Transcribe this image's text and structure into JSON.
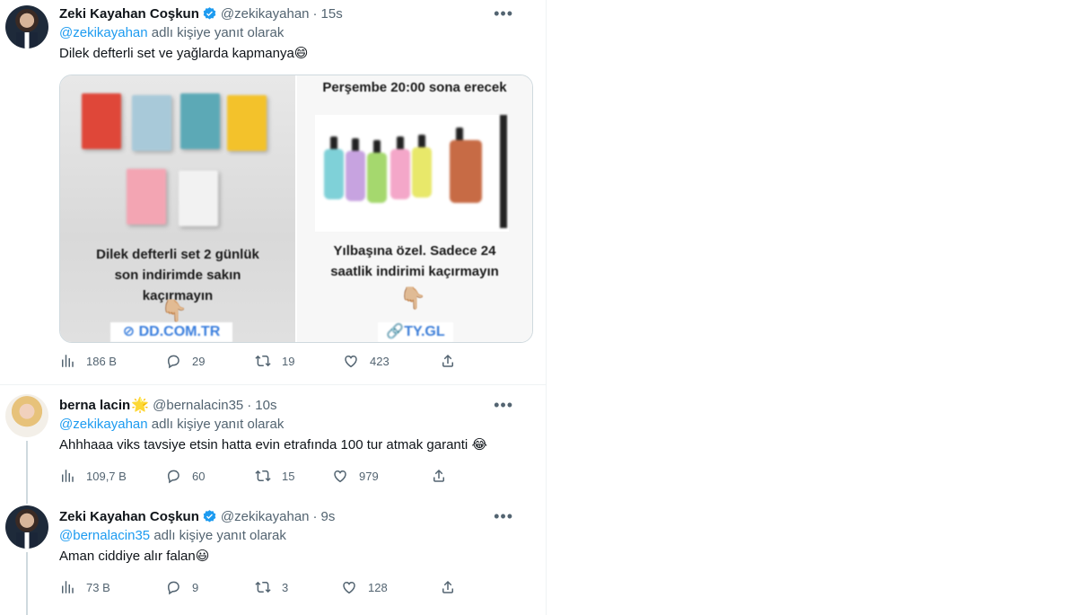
{
  "tweets": [
    {
      "name": "Zeki Kayahan Coşkun",
      "handle": "@zekikayahan",
      "time": "15s",
      "reply_mention": "@zekikayahan",
      "reply_suffix": "adlı kişiye yanıt olarak",
      "text": "Dilek defterli set ve yağlarda kapmanya",
      "emoji": "😄",
      "verified": true,
      "media": {
        "left_caption_1": "Dilek defterli set 2 günlük",
        "left_caption_2": "son indirimde sakın",
        "left_caption_3": "kaçırmayın",
        "left_link": "⊘ DD.COM.TR",
        "right_header": "Perşembe 20:00 sona erecek",
        "right_caption_1": "Yılbaşına özel. Sadece 24",
        "right_caption_2": "saatlik indirimi kaçırmayın",
        "right_link": "🔗TY.GL",
        "pointer": "👇🏼"
      },
      "views": "186 B",
      "replies": "29",
      "retweets": "19",
      "likes": "423"
    },
    {
      "name": "berna lacin",
      "name_emoji": "🌟",
      "handle": "@bernalacin35",
      "time": "10s",
      "reply_mention": "@zekikayahan",
      "reply_suffix": "adlı kişiye yanıt olarak",
      "text": "Ahhhaaa viks tavsiye etsin hatta evin etrafında 100 tur atmak garanti",
      "emoji": "😂",
      "views": "109,7 B",
      "replies": "60",
      "retweets": "15",
      "likes": "979"
    },
    {
      "name": "Zeki Kayahan Coşkun",
      "handle": "@zekikayahan",
      "time": "9s",
      "reply_mention": "@bernalacin35",
      "reply_suffix": "adlı kişiye yanıt olarak",
      "text": "Aman ciddiye alır falan",
      "emoji": "😃",
      "verified": true,
      "views": "73 B",
      "replies": "9",
      "retweets": "3",
      "likes": "128"
    }
  ],
  "more_label": "•••",
  "colors": {
    "accent": "#1d9bf0",
    "secondary_text": "#536471",
    "border": "#eff3f4"
  },
  "icons": [
    "verified-badge-icon",
    "more-icon",
    "views-icon",
    "reply-icon",
    "retweet-icon",
    "like-icon",
    "share-icon"
  ]
}
